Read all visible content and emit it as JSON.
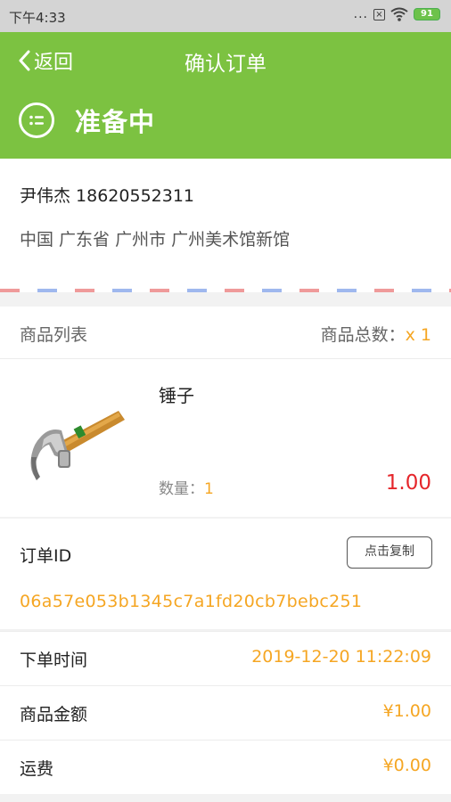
{
  "status_bar": {
    "time": "下午4:33",
    "dots": "...",
    "battery": "91"
  },
  "header": {
    "back_label": "返回",
    "title": "确认订单",
    "status": "准备中"
  },
  "address": {
    "name_phone": "尹伟杰 18620552311",
    "full_address": "中国 广东省 广州市 广州美术馆新馆"
  },
  "goods": {
    "list_label": "商品列表",
    "total_label": "商品总数：",
    "total_value": "x 1",
    "item": {
      "name": "锤子",
      "qty_label": "数量：",
      "qty_value": "1",
      "price": "1.00",
      "image": "hammer"
    }
  },
  "order": {
    "id_label": "订单ID",
    "copy_label": "点击复制",
    "id_value": "06a57e053b1345c7a1fd20cb7bebc251",
    "time_label": "下单时间",
    "time_value": "2019-12-20 11:22:09",
    "amount_label": "商品金额",
    "amount_value": "¥1.00",
    "shipping_label": "运费",
    "shipping_value": "¥0.00"
  },
  "colors": {
    "brand_green": "#7cc241",
    "accent_orange": "#f5a623",
    "price_red": "#e5262b"
  }
}
